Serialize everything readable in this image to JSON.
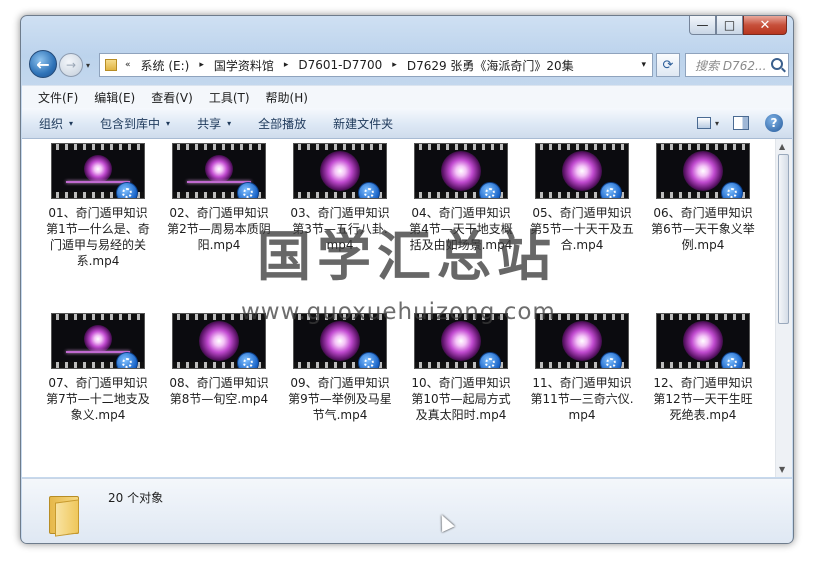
{
  "window": {
    "minimize": "—",
    "maximize": "□",
    "close": "✕"
  },
  "nav": {
    "back": "←",
    "forward": "→",
    "history_dropdown": "▾",
    "prefix": "«",
    "breadcrumbs": [
      "系统 (E:)",
      "国学资料馆",
      "D7601-D7700",
      "D7629 张勇《海派奇门》20集"
    ],
    "separator": "▸",
    "address_dropdown": "▾",
    "refresh": "⟳",
    "search_placeholder": "搜索 D762..."
  },
  "menu": [
    "文件(F)",
    "编辑(E)",
    "查看(V)",
    "工具(T)",
    "帮助(H)"
  ],
  "toolbar": {
    "organize": "组织",
    "include": "包含到库中",
    "share": "共享",
    "play_all": "全部播放",
    "new_folder": "新建文件夹",
    "caret": "▾",
    "help": "?"
  },
  "files": [
    {
      "name": "01、奇门遁甲知识第1节—什么是、奇门遁甲与易经的关系.mp4",
      "thumb": "bar"
    },
    {
      "name": "02、奇门遁甲知识第2节—周易本质阴阳.mp4",
      "thumb": "bar"
    },
    {
      "name": "03、奇门遁甲知识第3节—五行八卦.mp4",
      "thumb": "glow"
    },
    {
      "name": "04、奇门遁甲知识第4节—天干地支概括及由如场景.mp4",
      "thumb": "glow"
    },
    {
      "name": "05、奇门遁甲知识第5节—十天干及五合.mp4",
      "thumb": "glow"
    },
    {
      "name": "06、奇门遁甲知识第6节—天干象义举例.mp4",
      "thumb": "glow"
    },
    {
      "name": "07、奇门遁甲知识第7节—十二地支及象义.mp4",
      "thumb": "bar"
    },
    {
      "name": "08、奇门遁甲知识第8节—旬空.mp4",
      "thumb": "glow"
    },
    {
      "name": "09、奇门遁甲知识第9节—举例及马星节气.mp4",
      "thumb": "glow"
    },
    {
      "name": "10、奇门遁甲知识第10节—起局方式及真太阳时.mp4",
      "thumb": "glow"
    },
    {
      "name": "11、奇门遁甲知识第11节—三奇六仪.mp4",
      "thumb": "glow"
    },
    {
      "name": "12、奇门遁甲知识第12节—天干生旺死绝表.mp4",
      "thumb": "glow"
    }
  ],
  "status": {
    "count": "20 个对象"
  },
  "watermark": {
    "title": "国学汇总站",
    "url": "www.guoxuehuizong.com"
  },
  "colors": {
    "window_frame": "#c6d9ee",
    "toolbar_text": "#1e395b",
    "video_glow": "#c14bd0"
  }
}
